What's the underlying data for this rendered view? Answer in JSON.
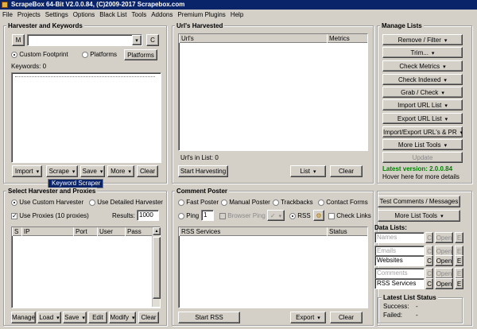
{
  "window": {
    "title": "ScrapeBox 64-Bit V2.0.0.84, (C)2009-2017 Scrapebox.com"
  },
  "menu": [
    "File",
    "Projects",
    "Settings",
    "Options",
    "Black List",
    "Tools",
    "Addons",
    "Premium Plugins",
    "Help"
  ],
  "harvester": {
    "title": "Harvester and Keywords",
    "m_button": "M",
    "c_button": "C",
    "custom_footprint": "Custom Footprint",
    "platforms_radio": "Platforms",
    "platforms_button": "Platforms",
    "keywords_label": "Keywords:",
    "keywords_count": "0",
    "import": "Import",
    "scrape": "Scrape",
    "save": "Save",
    "more": "More",
    "clear": "Clear",
    "scrape_menu_item": "Keyword Scraper"
  },
  "urls": {
    "title": "Url's Harvested",
    "col_url": "Url's",
    "col_metrics": "Metrics",
    "count_label": "Url's in List:",
    "count": "0",
    "start": "Start Harvesting",
    "list": "List",
    "clear": "Clear"
  },
  "manage": {
    "title": "Manage Lists",
    "buttons": [
      "Remove / Filter",
      "Trim...",
      "Check Metrics",
      "Check Indexed",
      "Grab / Check",
      "Import URL List",
      "Export URL List",
      "Import/Export URL's & PR",
      "More List Tools"
    ],
    "update": "Update",
    "latest_version": "Latest version: 2.0.0.84",
    "hover": "Hover here for more details"
  },
  "proxies": {
    "title": "Select Harvester and Proxies",
    "use_custom": "Use Custom Harvester",
    "use_detailed": "Use Detailed Harvester",
    "use_proxies": "Use Proxies (10 proxies)",
    "results_label": "Results:",
    "results": "1000",
    "cols": [
      "S",
      "IP",
      "Port",
      "User",
      "Pass"
    ],
    "manage": "Manage",
    "load": "Load",
    "save": "Save",
    "edit": "Edit",
    "modify": "Modify",
    "clear": "Clear"
  },
  "poster": {
    "title": "Comment Poster",
    "fast": "Fast Poster",
    "manual": "Manual Poster",
    "trackbacks": "Trackbacks",
    "contact": "Contact Forms",
    "ping": "Ping",
    "ping_value": "1",
    "browser_ping": "Browser Ping",
    "rss": "RSS",
    "check_links": "Check Links",
    "col_services": "RSS Services",
    "col_status": "Status",
    "start": "Start RSS",
    "export": "Export",
    "clear": "Clear",
    "test_comments": "Test Comments / Messages",
    "more_list_tools": "More List Tools"
  },
  "datalists": {
    "title": "Data Lists:",
    "items": [
      {
        "name": "Names",
        "open": "Open",
        "e": "E",
        "c": "C"
      },
      {
        "name": "Emails",
        "open": "Open",
        "e": "E",
        "c": "C"
      },
      {
        "name": "Websites",
        "open": "Open",
        "e": "E",
        "c": "C"
      },
      {
        "name": "Comments",
        "open": "Open",
        "e": "E",
        "c": "C"
      },
      {
        "name": "RSS Services",
        "open": "Open",
        "e": "E",
        "c": "C"
      }
    ]
  },
  "status": {
    "title": "Latest List Status",
    "success_label": "Success:",
    "success": "-",
    "failed_label": "Failed:",
    "failed": "-"
  }
}
